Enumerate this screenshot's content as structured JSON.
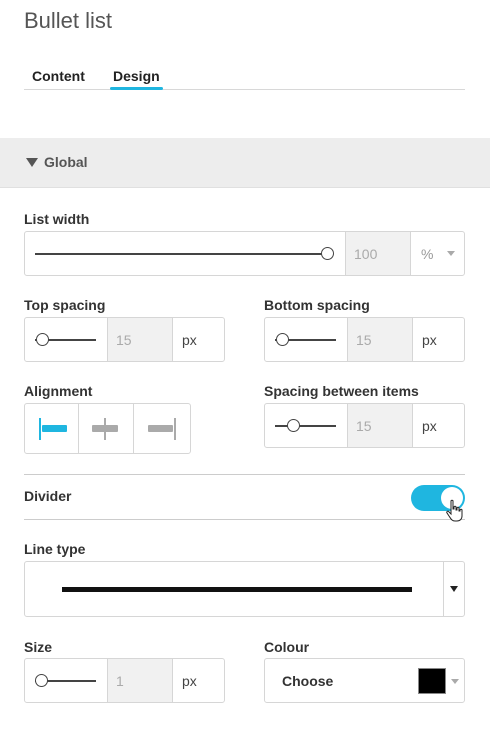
{
  "title": "Bullet list",
  "tabs": [
    {
      "label": "Content",
      "active": false
    },
    {
      "label": "Design",
      "active": true
    }
  ],
  "accent_color": "#1fb6e0",
  "section": {
    "label": "Global",
    "icon": "triangle-down-icon",
    "expanded": true
  },
  "list_width": {
    "label": "List width",
    "value": "100",
    "unit": "%",
    "slider_fraction": 1.0
  },
  "top_spacing": {
    "label": "Top spacing",
    "value": "15",
    "unit": "px",
    "slider_fraction": 0.05
  },
  "bottom_spacing": {
    "label": "Bottom spacing",
    "value": "15",
    "unit": "px",
    "slider_fraction": 0.05
  },
  "alignment": {
    "label": "Alignment",
    "options": [
      "left",
      "center",
      "right"
    ],
    "selected": "left"
  },
  "spacing_between": {
    "label": "Spacing between items",
    "value": "15",
    "unit": "px",
    "slider_fraction": 0.25
  },
  "divider": {
    "label": "Divider",
    "enabled": true
  },
  "line_type": {
    "label": "Line type",
    "selected": "solid"
  },
  "size": {
    "label": "Size",
    "value": "1",
    "unit": "px",
    "slider_fraction": 0.0
  },
  "colour": {
    "label": "Colour",
    "button_label": "Choose",
    "value": "#000000"
  }
}
